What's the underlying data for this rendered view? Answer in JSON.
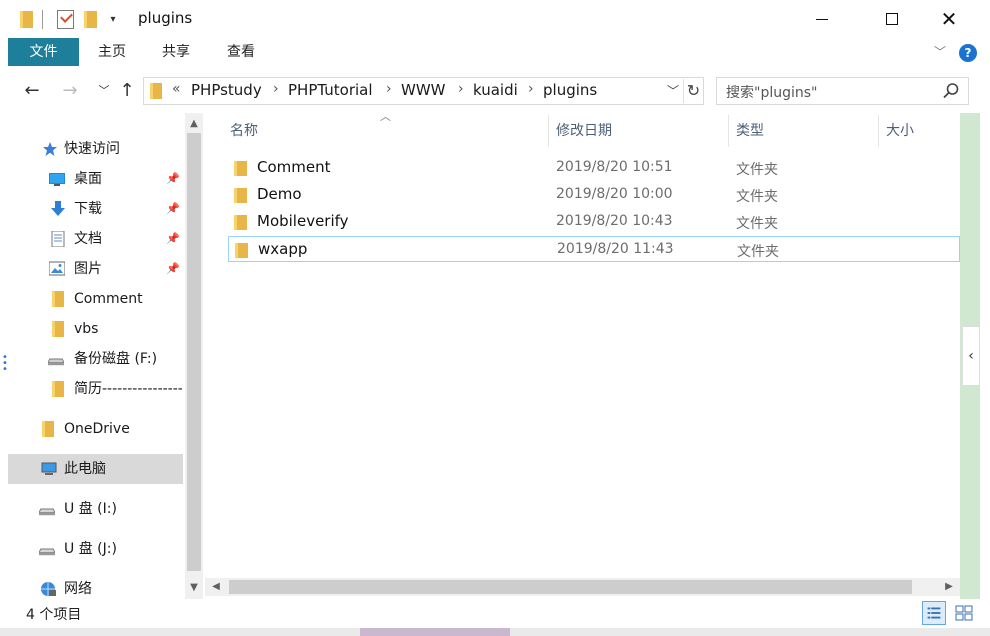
{
  "window": {
    "title": "plugins",
    "minimize_glyph": "",
    "close_glyph": "✕"
  },
  "ribbon": {
    "tabs": [
      "文件",
      "主页",
      "共享",
      "查看"
    ],
    "help_glyph": "?"
  },
  "address": {
    "overflow": "«",
    "breadcrumbs": [
      "PHPstudy",
      "PHPTutorial",
      "WWW",
      "kuaidi",
      "plugins"
    ],
    "search_placeholder": "搜索\"plugins\""
  },
  "nav_pane": {
    "items": [
      {
        "label": "快速访问",
        "icon": "star-icon",
        "pinned": false
      },
      {
        "label": "桌面",
        "icon": "desktop-icon",
        "pinned": true
      },
      {
        "label": "下载",
        "icon": "download-icon",
        "pinned": true
      },
      {
        "label": "文档",
        "icon": "document-icon",
        "pinned": true
      },
      {
        "label": "图片",
        "icon": "pictures-icon",
        "pinned": true
      },
      {
        "label": "Comment",
        "icon": "folder-icon",
        "pinned": false
      },
      {
        "label": "vbs",
        "icon": "folder-icon",
        "pinned": false
      },
      {
        "label": "备份磁盘 (F:)",
        "icon": "drive-icon",
        "pinned": false
      },
      {
        "label": "简历------------------",
        "icon": "folder-icon",
        "pinned": false
      },
      {
        "label": "OneDrive",
        "icon": "folder-icon",
        "pinned": false
      },
      {
        "label": "此电脑",
        "icon": "computer-icon",
        "pinned": false,
        "selected": true
      },
      {
        "label": "U 盘 (I:)",
        "icon": "usb-drive-icon",
        "pinned": false
      },
      {
        "label": "U 盘 (J:)",
        "icon": "usb-drive-icon",
        "pinned": false
      },
      {
        "label": "网络",
        "icon": "network-icon",
        "pinned": false
      }
    ]
  },
  "file_list": {
    "columns": [
      "名称",
      "修改日期",
      "类型",
      "大小"
    ],
    "rows": [
      {
        "name": "Comment",
        "date": "2019/8/20 10:51",
        "type": "文件夹"
      },
      {
        "name": "Demo",
        "date": "2019/8/20 10:00",
        "type": "文件夹"
      },
      {
        "name": "Mobileverify",
        "date": "2019/8/20 10:43",
        "type": "文件夹"
      },
      {
        "name": "wxapp",
        "date": "2019/8/20 11:43",
        "type": "文件夹",
        "selected": true
      }
    ]
  },
  "status": {
    "item_count": "4 个项目"
  },
  "colors": {
    "file_tab": "#1e7f9a",
    "folder": "#e8b548",
    "selection_border": "#99d1ff",
    "header_text": "#4c607a"
  }
}
